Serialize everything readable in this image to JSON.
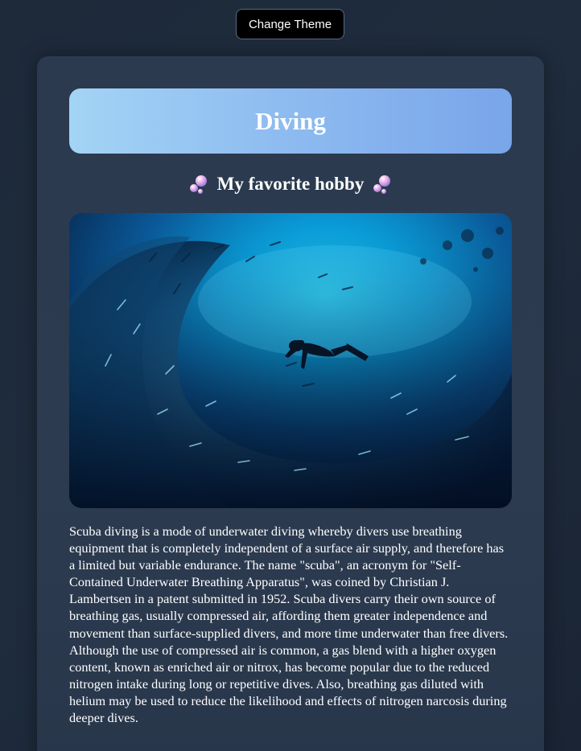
{
  "header": {
    "theme_button_label": "Change Theme"
  },
  "card": {
    "title": "Diving",
    "subtitle": "My favorite hobby",
    "subtitle_icon": "bubbles-icon",
    "image_alt": "scuba diver swimming among a school of fish",
    "description": "Scuba diving is a mode of underwater diving whereby divers use breathing equipment that is completely independent of a surface air supply, and therefore has a limited but variable endurance. The name \"scuba\", an acronym for \"Self-Contained Underwater Breathing Apparatus\", was coined by Christian J. Lambertsen in a patent submitted in 1952. Scuba divers carry their own source of breathing gas, usually compressed air, affording them greater independence and movement than surface-supplied divers, and more time underwater than free divers. Although the use of compressed air is common, a gas blend with a higher oxygen content, known as enriched air or nitrox, has become popular due to the reduced nitrogen intake during long or repetitive dives. Also, breathing gas diluted with helium may be used to reduce the likelihood and effects of nitrogen narcosis during deeper dives."
  },
  "colors": {
    "background": "#1e2a3a",
    "card": "#2b3a4f",
    "banner_start": "#a3d4f5",
    "banner_end": "#79a5ea",
    "button_bg": "#000000"
  }
}
